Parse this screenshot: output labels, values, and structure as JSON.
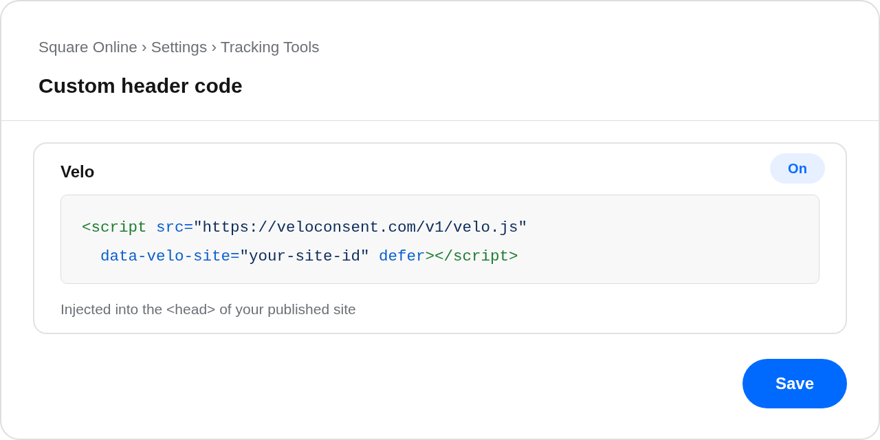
{
  "breadcrumb": "Square Online › Settings › Tracking Tools",
  "page_title": "Custom header code",
  "card": {
    "title": "Velo",
    "toggle": {
      "label": "On",
      "on": true
    },
    "code": {
      "lines": [
        {
          "indented": false,
          "tokens": [
            {
              "kind": "tag",
              "text": "<script"
            },
            {
              "kind": "attr",
              "text": " src="
            },
            {
              "kind": "string",
              "text": "\"https://veloconsent.com/v1/velo.js\""
            }
          ]
        },
        {
          "indented": true,
          "tokens": [
            {
              "kind": "attr",
              "text": "data-velo-site="
            },
            {
              "kind": "string",
              "text": "\"your-site-id\""
            },
            {
              "kind": "attr",
              "text": " defer"
            },
            {
              "kind": "tag",
              "text": "></script>"
            }
          ]
        }
      ]
    },
    "caption": "Injected into the <head> of your published site"
  },
  "buttons": [
    {
      "label": "Save",
      "kind": "primary"
    }
  ]
}
